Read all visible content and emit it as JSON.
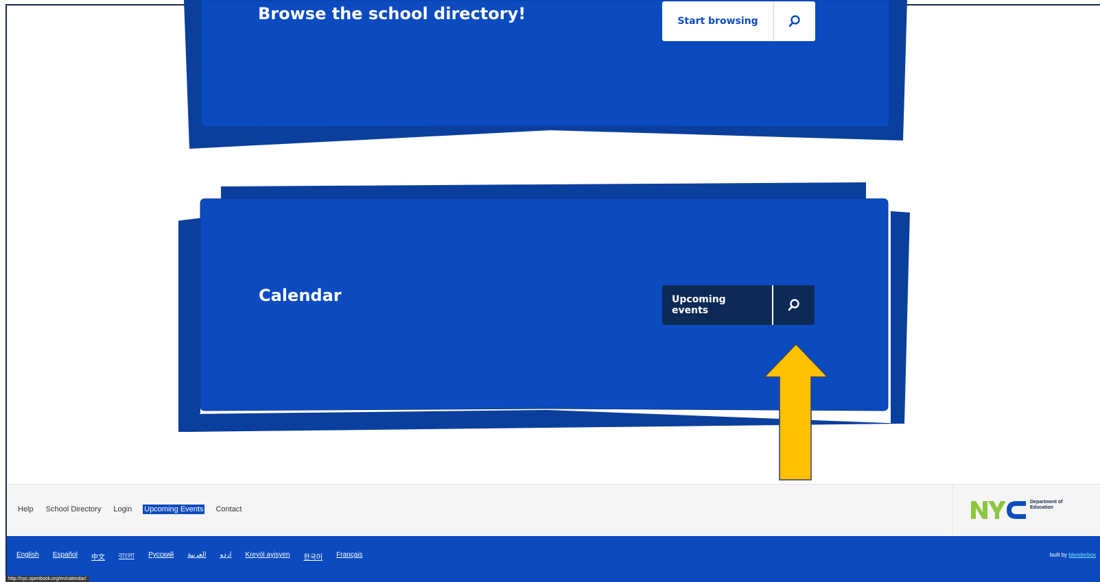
{
  "cards": {
    "directory": {
      "title": "Browse the school directory!",
      "button_label": "Start browsing",
      "icon": "search-icon"
    },
    "calendar": {
      "title": "Calendar",
      "button_label": "Upcoming events",
      "icon": "search-icon"
    }
  },
  "annotation": {
    "arrow_color": "#ffc000",
    "arrow_icon": "up-arrow-icon"
  },
  "footer": {
    "links": [
      "Help",
      "School Directory",
      "Login",
      "Upcoming Events",
      "Contact"
    ],
    "active_link": "Upcoming Events",
    "logo": {
      "mark": "NYC",
      "line1": "Department of",
      "line2": "Education"
    }
  },
  "languages": [
    "English",
    "Español",
    "中文",
    "বাংলা",
    "Русский",
    "العربية",
    "اردو",
    "Kreyòl ayisyen",
    "한국어",
    "Français"
  ],
  "built_by": {
    "prefix": "built by",
    "brand": "blenderbox"
  },
  "status_bar": {
    "url": "http://nyc.openbook.org/en/calendar/"
  },
  "colors": {
    "primary_blue": "#0b4bbf",
    "navy": "#0d2a57",
    "card_shadow": "#0a3f9e"
  }
}
